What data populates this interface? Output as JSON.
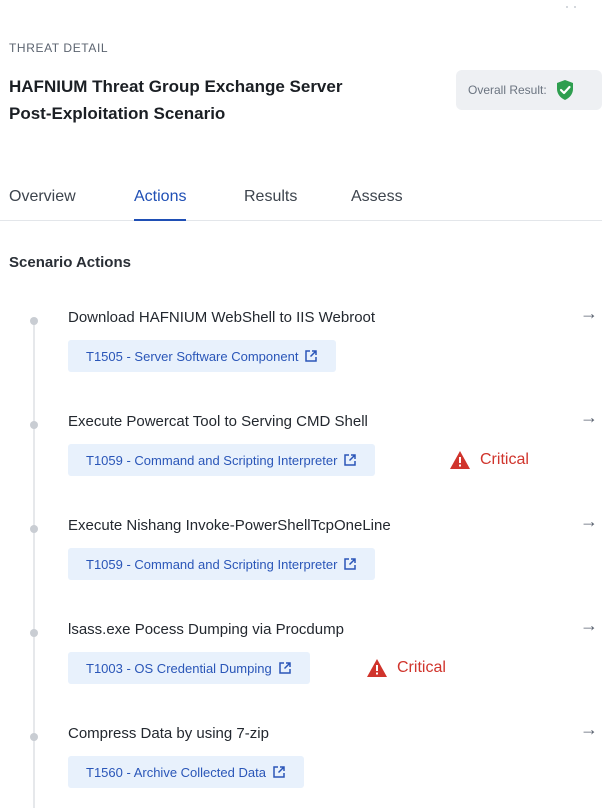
{
  "header": {
    "eyebrow": "THREAT DETAIL",
    "title_line1": "HAFNIUM Threat Group Exchange Server",
    "title_line2": "Post-Exploitation Scenario",
    "overall_result_label": "Overall Result:",
    "overall_result_icon": "shield-check-icon",
    "overall_result_color": "#2e9e4f"
  },
  "tabs": [
    {
      "label": "Overview",
      "active": false
    },
    {
      "label": "Actions",
      "active": true
    },
    {
      "label": "Results",
      "active": false
    },
    {
      "label": "Assess",
      "active": false
    }
  ],
  "section": {
    "title": "Scenario Actions"
  },
  "actions": [
    {
      "name": "Download HAFNIUM WebShell to IIS Webroot",
      "technique": "T1505 - Server Software Component",
      "critical": null
    },
    {
      "name": "Execute Powercat Tool to Serving CMD Shell",
      "technique": "T1059 - Command and Scripting Interpreter",
      "critical": "Critical"
    },
    {
      "name": "Execute Nishang Invoke-PowerShellTcpOneLine",
      "technique": "T1059 - Command and Scripting Interpreter",
      "critical": null
    },
    {
      "name": "lsass.exe Pocess Dumping via Procdump",
      "technique": "T1003 - OS Credential Dumping",
      "critical": "Critical"
    },
    {
      "name": "Compress Data by using 7-zip",
      "technique": "T1560 - Archive Collected Data",
      "critical": null
    }
  ],
  "colors": {
    "accent": "#1f4fb5",
    "link": "#2a56b8",
    "critical": "#d0342c",
    "technique_bg": "#e8f1fc"
  }
}
